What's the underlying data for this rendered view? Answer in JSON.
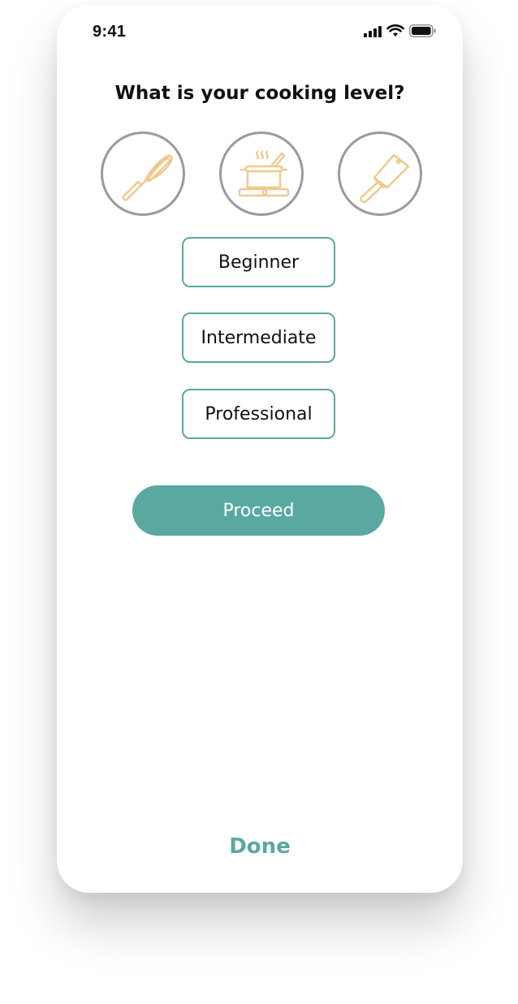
{
  "status_bar": {
    "time": "9:41"
  },
  "question": "What is your cooking level?",
  "level_icons": [
    {
      "icon": "whisk-icon"
    },
    {
      "icon": "cooking-pot-icon"
    },
    {
      "icon": "cleaver-icon"
    }
  ],
  "levels": [
    {
      "label": "Beginner"
    },
    {
      "label": "Intermediate"
    },
    {
      "label": "Professional"
    }
  ],
  "proceed_label": "Proceed",
  "done_label": "Done",
  "colors": {
    "accent": "#59a9a1",
    "icon_stroke": "#f0c98a",
    "circle_border": "#9b9b9b"
  }
}
